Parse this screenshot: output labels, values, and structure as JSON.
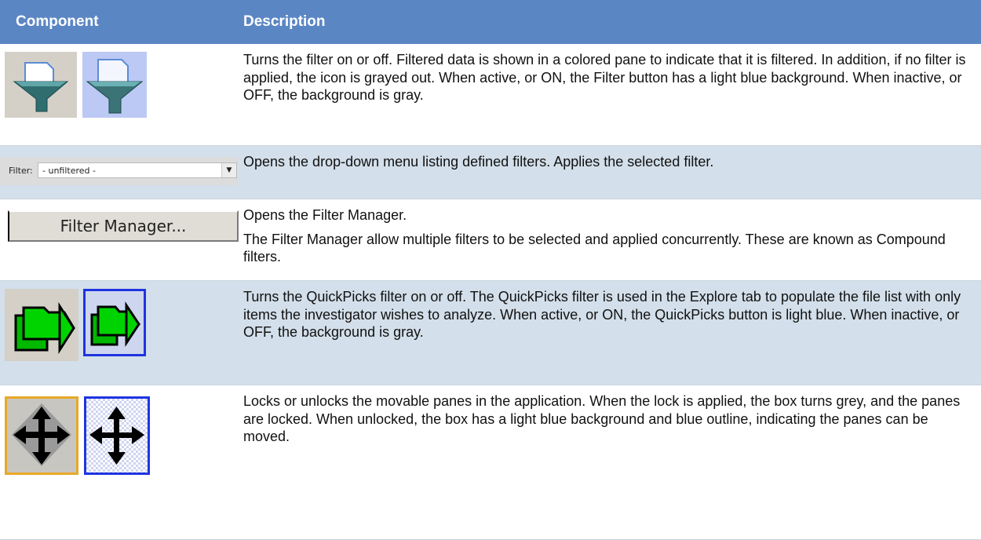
{
  "table": {
    "headers": {
      "component": "Component",
      "description": "Description"
    },
    "rows": [
      {
        "component_icons": [
          "filter-off-icon",
          "filter-on-icon"
        ],
        "description": [
          "Turns the filter on or off. Filtered data is shown in a colored pane to indicate that it is filtered. In addition, if no filter is applied, the icon is grayed out. When active, or ON, the Filter button has a light blue background. When inactive, or OFF, the background is gray."
        ]
      },
      {
        "component": {
          "label": "Filter:",
          "value": "- unfiltered -"
        },
        "description": [
          "Opens the drop-down menu listing defined filters. Applies the selected filter."
        ]
      },
      {
        "component": {
          "button_label": "Filter Manager..."
        },
        "description": [
          "Opens the Filter Manager.",
          "The Filter Manager allow multiple filters to be selected and applied concurrently. These are known as Compound filters."
        ]
      },
      {
        "component_icons": [
          "quickpicks-off-icon",
          "quickpicks-on-icon"
        ],
        "description": [
          "Turns the QuickPicks filter on or off. The QuickPicks filter is used in the Explore tab to populate the file list with only items the investigator wishes to analyze. When active, or ON, the QuickPicks button is light blue. When inactive, or OFF, the background is gray."
        ]
      },
      {
        "component_icons": [
          "pane-lock-locked-icon",
          "pane-lock-unlocked-icon"
        ],
        "description": [
          "Locks or unlocks the movable panes in the application. When the lock is applied, the box turns grey, and the panes are locked. When unlocked, the box has a light blue background and blue outline, indicating the panes can be moved."
        ]
      }
    ]
  },
  "colors": {
    "header_bg": "#5b86c4",
    "alt_row_bg": "#d3dfea",
    "active_blue_bg": "#bcc9f5",
    "inactive_gray_bg": "#d4d0c8",
    "active_outline": "#1e34e0",
    "locked_outline": "#e7a927",
    "quickpicks_green": "#00cc00"
  }
}
